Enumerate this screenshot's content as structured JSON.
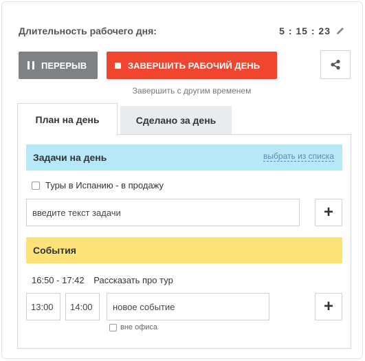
{
  "header": {
    "duration_label": "Длительность рабочего дня:",
    "duration_time": "5 : 15 : 23"
  },
  "actions": {
    "pause_label": "ПЕРЕРЫВ",
    "finish_label": "ЗАВЕРШИТЬ РАБОЧИЙ ДЕНЬ",
    "finish_other_label": "Завершить с другим временем",
    "share_icon": "share-icon"
  },
  "tabs": [
    {
      "label": "План на день",
      "active": true
    },
    {
      "label": "Сделано за день",
      "active": false
    }
  ],
  "tasks": {
    "title": "Задачи на день",
    "choose_link": "выбрать из списка",
    "items": [
      {
        "label": "Туры в Испанию - в продажу",
        "checked": false
      }
    ],
    "input_placeholder": "введите текст задачи",
    "add_label": "+"
  },
  "events": {
    "title": "События",
    "items": [
      {
        "time": "16:50 - 17:42",
        "label": "Рассказать про тур"
      }
    ],
    "start_value": "13:00",
    "end_value": "14:00",
    "input_placeholder": "новое событие",
    "add_label": "+",
    "offsite_label": "вне офиса"
  },
  "colors": {
    "pause_bg": "#7d8287",
    "finish_bg": "#f0452f",
    "tasks_bg": "#b7e8f7",
    "events_bg": "#fde27a",
    "link": "#5a8ab0"
  }
}
